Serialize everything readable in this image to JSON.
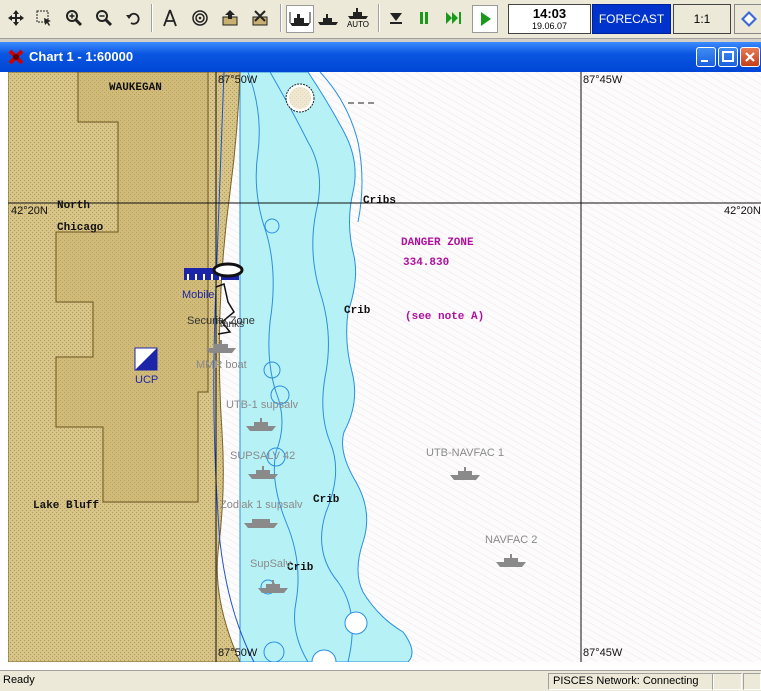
{
  "toolbar": {
    "time": "14:03",
    "date": "19.06.07",
    "forecast_label": "FORECAST",
    "scale_label": "1:1",
    "auto_label": "AUTO"
  },
  "window": {
    "title": "Chart 1 - 1:60000"
  },
  "chart": {
    "lon_labels": [
      "87°50W",
      "87°45W",
      "87°50W",
      "87°45W"
    ],
    "lat_labels": [
      "42°20N",
      "42°20N"
    ],
    "places": [
      "WAUKEGAN",
      "North",
      "Chicago",
      "Lake Bluff"
    ],
    "cribs": [
      "Cribs",
      "Crib",
      "Crib",
      "Crib"
    ],
    "danger_zone": {
      "title": "DANGER ZONE",
      "number": "334.830",
      "note": "(see note A)"
    },
    "ucp_label": "UCP",
    "mobile_label": "Mobile",
    "security_label": "Security Zone",
    "tanks_label": "Tanks",
    "vessels": [
      {
        "name": "MMR boat"
      },
      {
        "name": "UTB-1 supsalv"
      },
      {
        "name": "SUPSALV 42"
      },
      {
        "name": "UTB-NAVFAC 1"
      },
      {
        "name": "Zodiak 1 supsalv"
      },
      {
        "name": "NAVFAC 2"
      },
      {
        "name": "SupSalv"
      }
    ],
    "colors": {
      "land": "#d6c28a",
      "shallow": "#b6f1f5",
      "deep": "#fbfbfb",
      "danger": "#b0109c"
    }
  },
  "status": {
    "ready": "Ready",
    "network": "PISCES Network: Connecting"
  }
}
